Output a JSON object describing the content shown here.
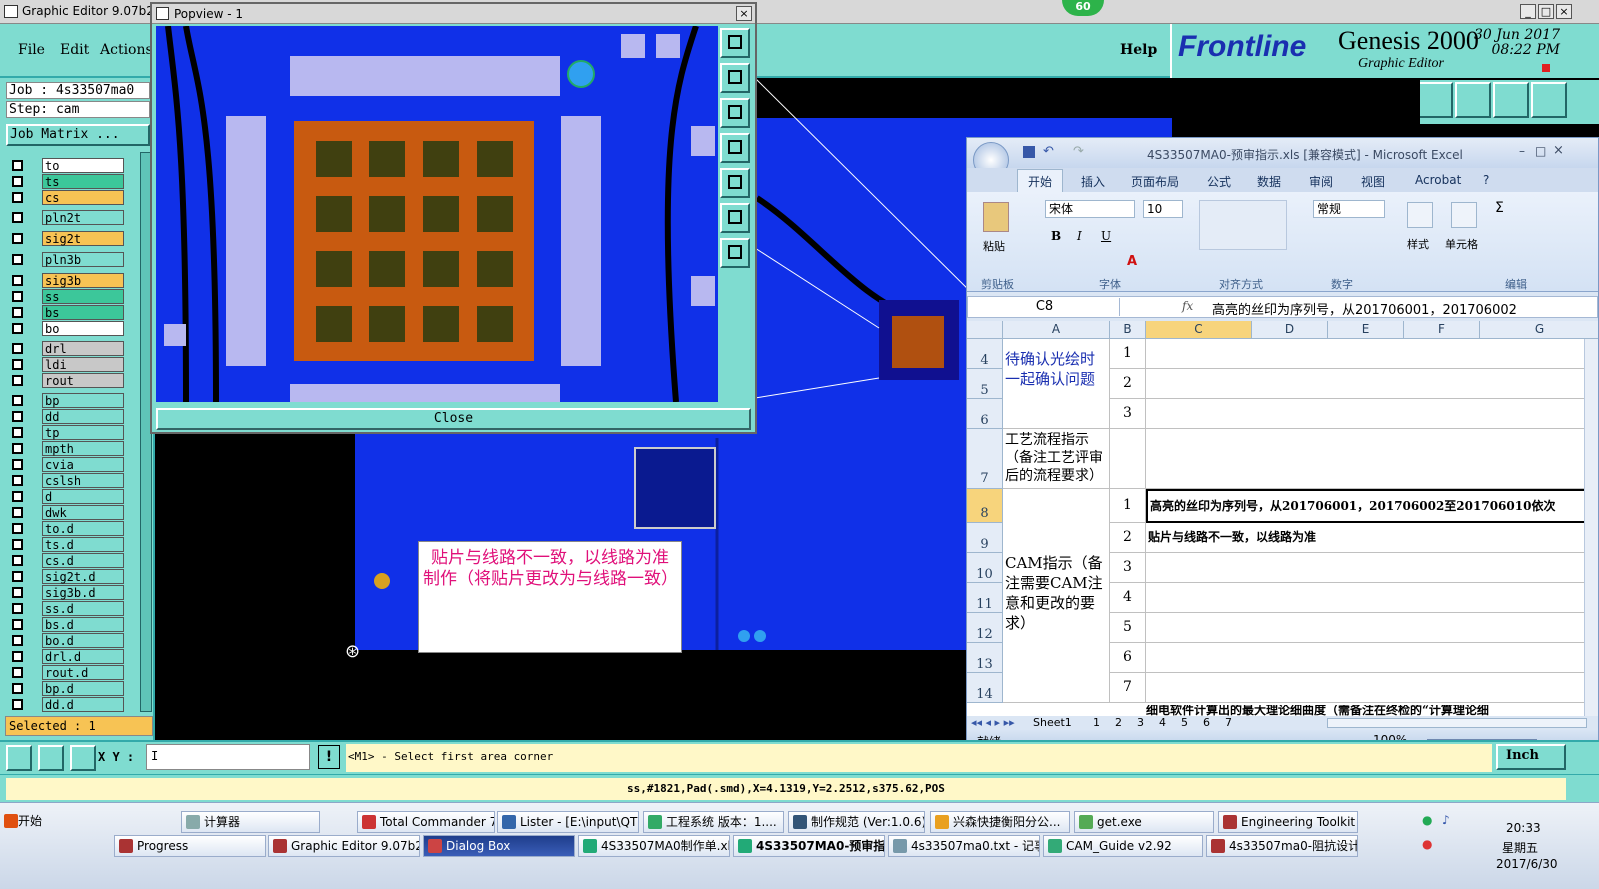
{
  "genesis": {
    "title": "Graphic Editor 9.07b2 (",
    "menus": [
      "File",
      "Edit",
      "Actions"
    ],
    "help": "Help",
    "brand": {
      "frontline": "Frontline",
      "product": "Genesis 2000",
      "sub": "Graphic Editor",
      "date": "30 Jun 2017",
      "time": "08:22 PM"
    },
    "badge": "60",
    "job": "Job : 4s33507ma0",
    "step": "Step: cam",
    "job_matrix": "Job Matrix ...",
    "layers": [
      {
        "name": "to",
        "color": "#ffffff"
      },
      {
        "name": "ts",
        "color": "#3cc79a"
      },
      {
        "name": "cs",
        "color": "#f7c354"
      },
      {
        "name": "pln2t",
        "color": "#7fdcd0"
      },
      {
        "name": "sig2t",
        "color": "#f7c354"
      },
      {
        "name": "pln3b",
        "color": "#7fdcd0"
      },
      {
        "name": "sig3b",
        "color": "#f7c354"
      },
      {
        "name": "ss",
        "color": "#3cc79a"
      },
      {
        "name": "bs",
        "color": "#3cc79a"
      },
      {
        "name": "bo",
        "color": "#ffffff"
      },
      {
        "name": "drl",
        "color": "#c8c8c8"
      },
      {
        "name": "ldi",
        "color": "#c8c8c8"
      },
      {
        "name": "rout",
        "color": "#c8c8c8"
      },
      {
        "name": "bp",
        "color": "#7fdcd0"
      },
      {
        "name": "dd",
        "color": "#7fdcd0"
      },
      {
        "name": "tp",
        "color": "#7fdcd0"
      },
      {
        "name": "mpth",
        "color": "#7fdcd0"
      },
      {
        "name": "cvia",
        "color": "#7fdcd0"
      },
      {
        "name": "cslsh",
        "color": "#7fdcd0"
      },
      {
        "name": "d",
        "color": "#7fdcd0"
      },
      {
        "name": "dwk",
        "color": "#7fdcd0"
      },
      {
        "name": "to.d",
        "color": "#7fdcd0"
      },
      {
        "name": "ts.d",
        "color": "#7fdcd0"
      },
      {
        "name": "cs.d",
        "color": "#7fdcd0"
      },
      {
        "name": "sig2t.d",
        "color": "#7fdcd0"
      },
      {
        "name": "sig3b.d",
        "color": "#7fdcd0"
      },
      {
        "name": "ss.d",
        "color": "#7fdcd0"
      },
      {
        "name": "bs.d",
        "color": "#7fdcd0"
      },
      {
        "name": "bo.d",
        "color": "#7fdcd0"
      },
      {
        "name": "drl.d",
        "color": "#7fdcd0"
      },
      {
        "name": "rout.d",
        "color": "#7fdcd0"
      },
      {
        "name": "bp.d",
        "color": "#7fdcd0"
      },
      {
        "name": "dd.d",
        "color": "#7fdcd0"
      }
    ],
    "selected": "Selected : 1",
    "xy_label": "X Y :",
    "xy_value": "I",
    "prompt": "<M1> - Select first area corner",
    "units": "Inch",
    "status": "ss,#1821,Pad(.smd),X=4.1319,Y=2.2512,s375.62,POS",
    "annotation": "贴片与线路不一致，以线路为准制作（将贴片更改为与线路一致）"
  },
  "popview": {
    "title": "Popview - 1",
    "close": "Close"
  },
  "excel": {
    "title": "4S33507MA0-预审指示.xls [兼容模式] - Microsoft Excel",
    "tabs": [
      "开始",
      "插入",
      "页面布局",
      "公式",
      "数据",
      "审阅",
      "视图",
      "Acrobat"
    ],
    "font_name": "宋体",
    "font_size": "10",
    "number_format": "常规",
    "ribbon_labels": {
      "paste": "粘贴",
      "styles": "样式",
      "cells": "单元格"
    },
    "groups": [
      "剪贴板",
      "字体",
      "对齐方式",
      "数字",
      "编辑"
    ],
    "name_box": "C8",
    "fx": "fx",
    "formula": "高亮的丝印为序列号，从201706001，201706002",
    "columns": [
      "A",
      "B",
      "C",
      "D",
      "E",
      "F",
      "G"
    ],
    "rows": [
      "4",
      "5",
      "6",
      "7",
      "8",
      "9",
      "10",
      "11",
      "12",
      "13",
      "14"
    ],
    "labels": {
      "pending": "待确认光绘时一起确认问题",
      "process": "工艺流程指示（备注工艺评审后的流程要求）",
      "cam": "CAM指示（备注需要CAM注意和更改的要求）"
    },
    "numbers": [
      "1",
      "2",
      "3",
      "1",
      "2",
      "3",
      "4",
      "5",
      "6",
      "7"
    ],
    "c8": "高亮的丝印为序列号，从201706001，201706002至201706010依次",
    "c9": "贴片与线路不一致，以线路为准",
    "c15": "细电软件计算出的最大理论细曲度（需备注在终检的“计算理论细",
    "sheet_tabs": [
      "Sheet1",
      "1",
      "2",
      "3",
      "4",
      "5",
      "6",
      "7"
    ],
    "status_ready": "就绪",
    "zoom": "100%"
  },
  "taskbar": {
    "start": "开始",
    "row1": [
      "计算器",
      "Total Commander 7.0...",
      "Lister - [E:\\input\\QTP...",
      "工程系统  版本：1....",
      "制作规范 (Ver:1.0.6)",
      "兴森快捷衡阳分公...",
      "get.exe",
      "Engineering Toolkit 9...."
    ],
    "row2": [
      "Progress",
      "Graphic Editor 9.07b2 (0...",
      "Dialog Box",
      "4S33507MA0制作单.xls...",
      "4S33507MA0-预审指...",
      "4s33507ma0.txt - 记事本",
      "CAM_Guide v2.92",
      "4s33507ma0-阻抗设计(..."
    ],
    "clock": "20:33",
    "weekday": "星期五",
    "date": "2017/6/30"
  }
}
